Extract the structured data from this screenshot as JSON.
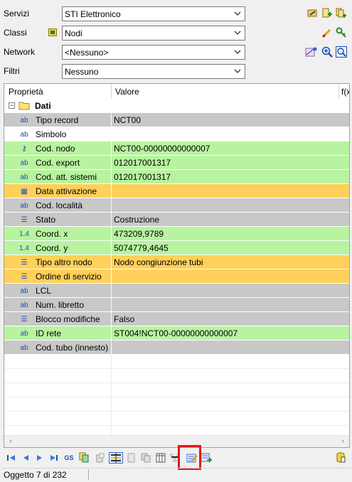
{
  "form": {
    "servizi": {
      "label": "Servizi",
      "value": "STI Elettronico"
    },
    "classi": {
      "label": "Classi",
      "value": "Nodi"
    },
    "network": {
      "label": "Network",
      "value": "<Nessuno>"
    },
    "filtri": {
      "label": "Filtri",
      "value": "Nessuno"
    }
  },
  "grid": {
    "headers": {
      "property": "Proprietà",
      "value": "Valore",
      "formula": "f(x"
    },
    "group": {
      "expander": "−",
      "label": "Dati"
    },
    "rows": [
      {
        "icon_text": "ab",
        "icon": "text-type-icon",
        "name": "Tipo record",
        "value": "NCT00",
        "color": "#c8c8c8"
      },
      {
        "icon_text": "ab",
        "icon": "text-type-icon",
        "name": "Simbolo",
        "value": "",
        "color": "#ffffff"
      },
      {
        "icon_text": "⚷",
        "icon": "key-icon",
        "name": "Cod. nodo",
        "value": "NCT00-00000000000007",
        "color": "#b8f3a0"
      },
      {
        "icon_text": "ab",
        "icon": "text-type-icon",
        "name": "Cod. export",
        "value": "012017001317",
        "color": "#b8f3a0"
      },
      {
        "icon_text": "ab",
        "icon": "text-type-icon",
        "name": "Cod. att. sistemi",
        "value": "012017001317",
        "color": "#b8f3a0"
      },
      {
        "icon_text": "▦",
        "icon": "calendar-icon",
        "name": "Data attivazione",
        "value": "",
        "color": "#ffd05a"
      },
      {
        "icon_text": "ab",
        "icon": "text-type-icon",
        "name": "Cod. località",
        "value": "",
        "color": "#c8c8c8"
      },
      {
        "icon_text": "☰",
        "icon": "list-type-icon",
        "name": "Stato",
        "value": "Costruzione",
        "color": "#c8c8c8"
      },
      {
        "icon_text": "1.4",
        "icon": "number-type-icon",
        "name": "Coord. x",
        "value": "473209,9789",
        "color": "#b8f3a0"
      },
      {
        "icon_text": "1.4",
        "icon": "number-type-icon",
        "name": "Coord. y",
        "value": "5074779,4645",
        "color": "#b8f3a0"
      },
      {
        "icon_text": "☰",
        "icon": "list-type-icon",
        "name": "Tipo altro nodo",
        "value": "Nodo congiunzione tubi",
        "color": "#ffd05a"
      },
      {
        "icon_text": "☰",
        "icon": "list-type-icon",
        "name": "Ordine di servizio",
        "value": "",
        "color": "#ffd05a"
      },
      {
        "icon_text": "ab",
        "icon": "text-type-icon",
        "name": "LCL",
        "value": "",
        "color": "#c8c8c8"
      },
      {
        "icon_text": "ab",
        "icon": "text-type-icon",
        "name": "Num. libretto",
        "value": "",
        "color": "#c8c8c8"
      },
      {
        "icon_text": "☰",
        "icon": "list-type-icon",
        "name": "Blocco modifiche",
        "value": "Falso",
        "color": "#c8c8c8"
      },
      {
        "icon_text": "ab",
        "icon": "text-type-icon",
        "name": "ID rete",
        "value": "ST004!NCT00-00000000000007",
        "color": "#b8f3a0"
      },
      {
        "icon_text": "ab",
        "icon": "text-type-icon",
        "name": "Cod. tubo (innesto)",
        "value": "",
        "color": "#c8c8c8"
      }
    ]
  },
  "toolbar_bottom": {
    "gs_label": "GS"
  },
  "status": {
    "text": "Oggetto 7 di 232"
  },
  "colors": {
    "gray_row": "#c8c8c8",
    "green_row": "#b8f3a0",
    "orange_row": "#ffd05a",
    "highlight": "#e8141b"
  }
}
